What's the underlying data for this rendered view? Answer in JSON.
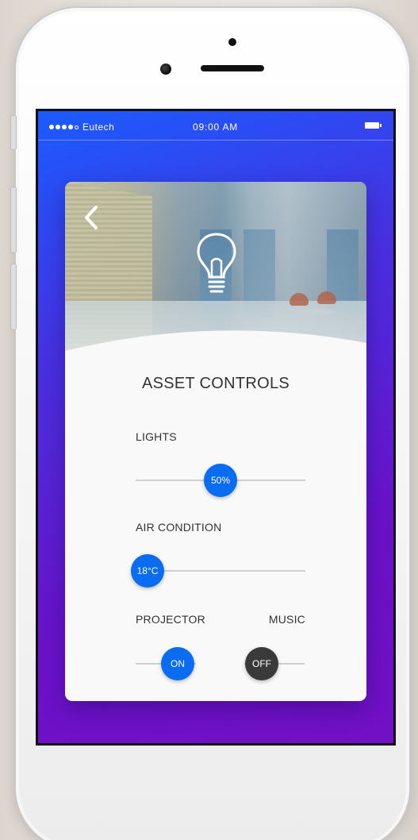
{
  "status_bar": {
    "carrier": "Eutech",
    "time": "09:00 AM",
    "signal_bars_filled": 4,
    "signal_bars_total": 5
  },
  "card": {
    "back_icon": "chevron-left-icon",
    "hero_icon": "lightbulb-icon",
    "title": "ASSET CONTROLS",
    "lights": {
      "label": "LIGHTS",
      "value": "50%",
      "fraction": 0.5
    },
    "air_condition": {
      "label": "AIR CONDITION",
      "value": "18°C",
      "fraction": 0.0
    },
    "projector": {
      "label": "PROJECTOR",
      "state": "ON"
    },
    "music": {
      "label": "MUSIC",
      "state": "OFF"
    }
  },
  "colors": {
    "accent": "#0a6cf0",
    "toggle_off": "#3a3a3a",
    "gradient_start": "#1a5cff",
    "gradient_end": "#7210c4"
  }
}
